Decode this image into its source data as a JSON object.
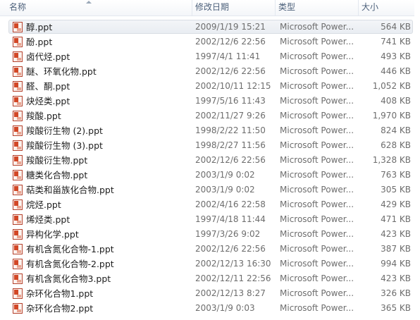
{
  "columns": {
    "name": "名称",
    "date": "修改日期",
    "type": "类型",
    "size": "大小"
  },
  "selected_index": 0,
  "icon": "powerpoint-file-icon",
  "files": [
    {
      "name": "醇.ppt",
      "date": "2009/1/19 15:21",
      "type": "Microsoft Power...",
      "size": "564 KB"
    },
    {
      "name": "酚.ppt",
      "date": "2002/12/6 22:56",
      "type": "Microsoft Power...",
      "size": "741 KB"
    },
    {
      "name": "卤代烃.ppt",
      "date": "1997/4/1 11:41",
      "type": "Microsoft Power...",
      "size": "493 KB"
    },
    {
      "name": "醚、环氧化物.ppt",
      "date": "2002/12/6 22:56",
      "type": "Microsoft Power...",
      "size": "446 KB"
    },
    {
      "name": "醛、酮.ppt",
      "date": "2002/10/11 12:15",
      "type": "Microsoft Power...",
      "size": "1,052 KB"
    },
    {
      "name": "炔烃类.ppt",
      "date": "1997/5/16 11:43",
      "type": "Microsoft Power...",
      "size": "408 KB"
    },
    {
      "name": "羧酸.ppt",
      "date": "2002/11/27 9:26",
      "type": "Microsoft Power...",
      "size": "1,970 KB"
    },
    {
      "name": "羧酸衍生物 (2).ppt",
      "date": "1998/2/22 11:50",
      "type": "Microsoft Power...",
      "size": "824 KB"
    },
    {
      "name": "羧酸衍生物 (3).ppt",
      "date": "1998/2/27 11:56",
      "type": "Microsoft Power...",
      "size": "628 KB"
    },
    {
      "name": "羧酸衍生物.ppt",
      "date": "2002/12/6 22:56",
      "type": "Microsoft Power...",
      "size": "1,328 KB"
    },
    {
      "name": "糖类化合物.ppt",
      "date": "2003/1/9 0:02",
      "type": "Microsoft Power...",
      "size": "763 KB"
    },
    {
      "name": "萜类和甾族化合物.ppt",
      "date": "2003/1/9 0:02",
      "type": "Microsoft Power...",
      "size": "305 KB"
    },
    {
      "name": "烷烃.ppt",
      "date": "2002/4/16 22:58",
      "type": "Microsoft Power...",
      "size": "429 KB"
    },
    {
      "name": "烯烃类.ppt",
      "date": "1997/4/18 11:44",
      "type": "Microsoft Power...",
      "size": "471 KB"
    },
    {
      "name": "异构化学.ppt",
      "date": "1997/3/26 9:02",
      "type": "Microsoft Power...",
      "size": "423 KB"
    },
    {
      "name": "有机含氮化合物-1.ppt",
      "date": "2002/12/6 22:56",
      "type": "Microsoft Power...",
      "size": "387 KB"
    },
    {
      "name": "有机含氮化合物-2.ppt",
      "date": "2002/12/13 16:30",
      "type": "Microsoft Power...",
      "size": "994 KB"
    },
    {
      "name": "有机含氮化合物3.ppt",
      "date": "2002/12/11 22:56",
      "type": "Microsoft Power...",
      "size": "423 KB"
    },
    {
      "name": "杂环化合物1.ppt",
      "date": "2002/12/13 8:27",
      "type": "Microsoft Power...",
      "size": "326 KB"
    },
    {
      "name": "杂环化合物2.ppt",
      "date": "2003/1/9 0:03",
      "type": "Microsoft Power...",
      "size": "365 KB"
    }
  ]
}
